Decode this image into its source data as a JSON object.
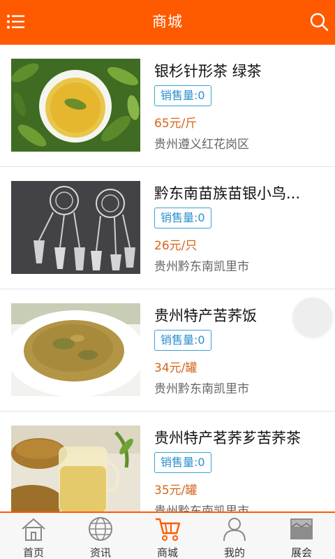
{
  "header": {
    "title": "商城",
    "menu_icon": "menu-icon",
    "search_icon": "search-icon",
    "bg_color": "#ff5a00"
  },
  "products": [
    {
      "name": "银杉针形茶 绿茶",
      "sales": "销售量:0",
      "price": "65元/斤",
      "location": "贵州遵义红花岗区"
    },
    {
      "name": "黔东南苗族苗银小鸟...",
      "sales": "销售量:0",
      "price": "26元/只",
      "location": "贵州黔东南凯里市"
    },
    {
      "name": "贵州特产苦荞饭",
      "sales": "销售量:0",
      "price": "34元/罐",
      "location": "贵州黔东南凯里市"
    },
    {
      "name": "贵州特产茗荞芗苦荞茶",
      "sales": "销售量:0",
      "price": "35元/罐",
      "location": "贵州黔东南凯里市"
    }
  ],
  "tabs": [
    {
      "label": "首页",
      "icon": "home-icon"
    },
    {
      "label": "资讯",
      "icon": "globe-icon"
    },
    {
      "label": "商城",
      "icon": "cart-icon",
      "active": true
    },
    {
      "label": "我的",
      "icon": "user-icon"
    },
    {
      "label": "展会",
      "icon": "exhibition-icon"
    }
  ],
  "colors": {
    "accent": "#ff5a00",
    "price": "#d4661c",
    "badge": "#2a8fcf"
  }
}
